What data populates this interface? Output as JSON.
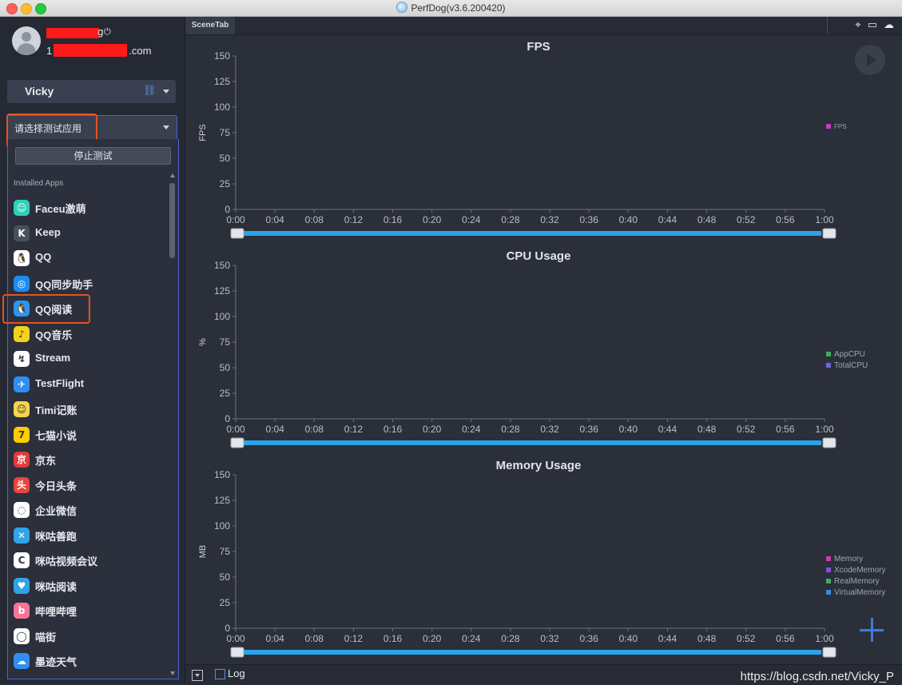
{
  "window": {
    "title": "PerfDog(v3.6.200420)"
  },
  "user": {
    "name_suffix": "g",
    "email_prefix": "1",
    "email_suffix": ".com"
  },
  "device": {
    "name": "Vicky"
  },
  "app_select": {
    "placeholder": "请选择测试应用"
  },
  "dropdown": {
    "stop_button": "停止测试",
    "section_label": "Installed Apps",
    "apps": [
      {
        "label": "Faceu激萌",
        "icon": "faceu-icon",
        "color": "#2fd0b6",
        "glyph": "☺"
      },
      {
        "label": "Keep",
        "icon": "keep-icon",
        "color": "#4a4f5c",
        "glyph": "K"
      },
      {
        "label": "QQ",
        "icon": "qq-icon",
        "color": "#ffffff",
        "glyph": "🐧"
      },
      {
        "label": "QQ同步助手",
        "icon": "qq-sync-icon",
        "color": "#1c8df0",
        "glyph": "◎"
      },
      {
        "label": "QQ阅读",
        "icon": "qq-reader-icon",
        "color": "#2b95f0",
        "glyph": "🐧"
      },
      {
        "label": "QQ音乐",
        "icon": "qq-music-icon",
        "color": "#f2d21b",
        "glyph": "♪"
      },
      {
        "label": "Stream",
        "icon": "stream-icon",
        "color": "#ffffff",
        "glyph": "↯"
      },
      {
        "label": "TestFlight",
        "icon": "testflight-icon",
        "color": "#2f8ff0",
        "glyph": "✈"
      },
      {
        "label": "Timi记账",
        "icon": "timi-icon",
        "color": "#f6d34a",
        "glyph": "☺"
      },
      {
        "label": "七猫小说",
        "icon": "qimao-icon",
        "color": "#ffcc00",
        "glyph": "7"
      },
      {
        "label": "京东",
        "icon": "jd-icon",
        "color": "#e4393c",
        "glyph": "京"
      },
      {
        "label": "今日头条",
        "icon": "toutiao-icon",
        "color": "#e8453c",
        "glyph": "头"
      },
      {
        "label": "企业微信",
        "icon": "wecom-icon",
        "color": "#ffffff",
        "glyph": "◌"
      },
      {
        "label": "咪咕善跑",
        "icon": "migu-run-icon",
        "color": "#2fa4e7",
        "glyph": "✕"
      },
      {
        "label": "咪咕视频会议",
        "icon": "migu-meeting-icon",
        "color": "#ffffff",
        "glyph": "C"
      },
      {
        "label": "咪咕阅读",
        "icon": "migu-read-icon",
        "color": "#2fa4e7",
        "glyph": "♥"
      },
      {
        "label": "哔哩哔哩",
        "icon": "bilibili-icon",
        "color": "#fb7299",
        "glyph": "b"
      },
      {
        "label": "喵街",
        "icon": "miaojie-icon",
        "color": "#ffffff",
        "glyph": "◯"
      },
      {
        "label": "墨迹天气",
        "icon": "moji-icon",
        "color": "#2f8ff0",
        "glyph": "☁"
      }
    ]
  },
  "main": {
    "scene_tab": "SceneTab",
    "log_label": "Log",
    "watermark": "https://blog.csdn.net/Vicky_P"
  },
  "chart_data": [
    {
      "type": "line",
      "title": "FPS",
      "ylabel": "FPS",
      "xlabel": "",
      "ylim": [
        0,
        150
      ],
      "yticks": [
        "0",
        "25",
        "50",
        "75",
        "100",
        "125",
        "150"
      ],
      "x": [
        "0:00",
        "0:04",
        "0:08",
        "0:12",
        "0:16",
        "0:20",
        "0:24",
        "0:28",
        "0:32",
        "0:36",
        "0:40",
        "0:44",
        "0:48",
        "0:52",
        "0:56",
        "1:00"
      ],
      "series": [
        {
          "name": "FPS",
          "color": "#c23fb8",
          "values": []
        }
      ],
      "grid": false,
      "legend": "right"
    },
    {
      "type": "line",
      "title": "CPU Usage",
      "ylabel": "%",
      "xlabel": "",
      "ylim": [
        0,
        150
      ],
      "yticks": [
        "0",
        "25",
        "50",
        "75",
        "100",
        "125",
        "150"
      ],
      "x": [
        "0:00",
        "0:04",
        "0:08",
        "0:12",
        "0:16",
        "0:20",
        "0:24",
        "0:28",
        "0:32",
        "0:36",
        "0:40",
        "0:44",
        "0:48",
        "0:52",
        "0:56",
        "1:00"
      ],
      "series": [
        {
          "name": "AppCPU",
          "color": "#3fae5a",
          "values": []
        },
        {
          "name": "TotalCPU",
          "color": "#6b68d8",
          "values": []
        }
      ],
      "grid": false,
      "legend": "right"
    },
    {
      "type": "line",
      "title": "Memory Usage",
      "ylabel": "MB",
      "xlabel": "",
      "ylim": [
        0,
        150
      ],
      "yticks": [
        "0",
        "25",
        "50",
        "75",
        "100",
        "125",
        "150"
      ],
      "x": [
        "0:00",
        "0:04",
        "0:08",
        "0:12",
        "0:16",
        "0:20",
        "0:24",
        "0:28",
        "0:32",
        "0:36",
        "0:40",
        "0:44",
        "0:48",
        "0:52",
        "0:56",
        "1:00"
      ],
      "series": [
        {
          "name": "Memory",
          "color": "#c23fb8",
          "values": []
        },
        {
          "name": "XcodeMemory",
          "color": "#8a4fd8",
          "values": []
        },
        {
          "name": "RealMemory",
          "color": "#3fae5a",
          "values": []
        },
        {
          "name": "VirtualMemory",
          "color": "#3c8ad8",
          "values": []
        }
      ],
      "grid": false,
      "legend": "right"
    }
  ]
}
